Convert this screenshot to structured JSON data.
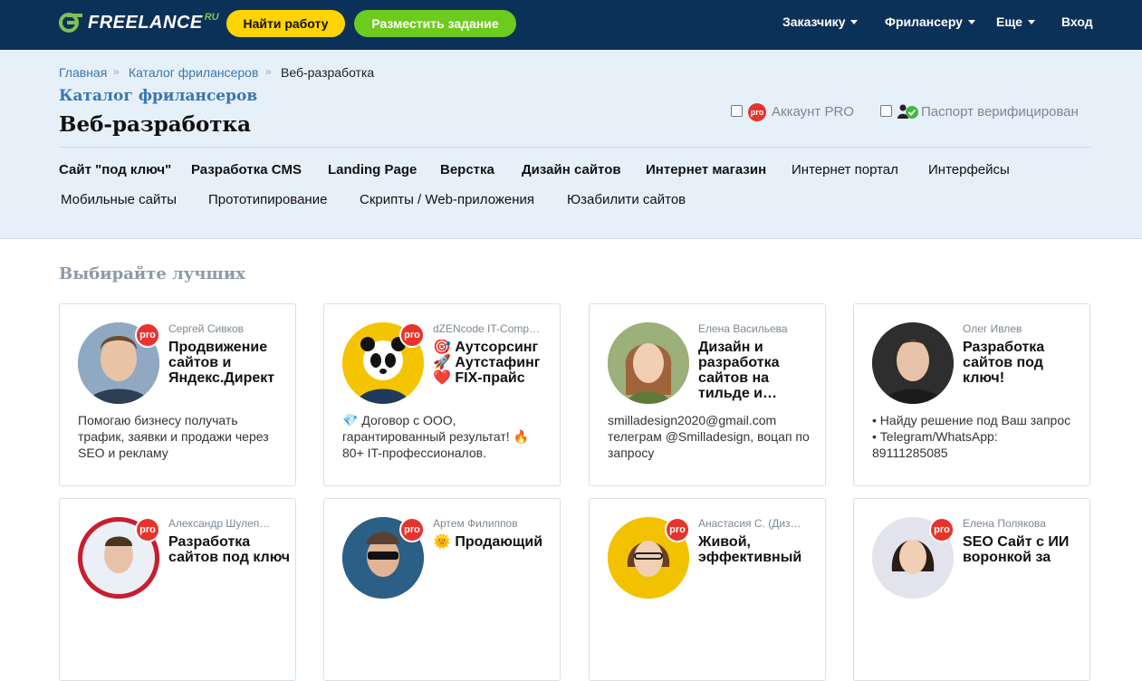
{
  "header": {
    "logo_text": "FREELANCE",
    "logo_ru": "RU",
    "find_work": "Найти работу",
    "post_task": "Разместить задание",
    "nav": [
      "Заказчику",
      "Фрилансеру",
      "Еще"
    ],
    "login": "Вход"
  },
  "breadcrumbs": [
    "Главная",
    "Каталог фрилансеров",
    "Веб-разработка"
  ],
  "breadcrumb_sep": "»",
  "catalog_link": "Каталог фрилансеров",
  "page_title": "Веб-разработка",
  "filters": {
    "pro_badge": "pro",
    "pro_label": "Аккаунт PRO",
    "passport_label": "Паспорт верифицирован"
  },
  "specs_row1": [
    "Сайт \"под ключ\"",
    "Разработка CMS",
    "Landing Page",
    "Верстка",
    "Дизайн сайтов",
    "Интернет магазин",
    "Интернет портал",
    "Интерфейсы"
  ],
  "specs_row2": [
    "Мобильные сайты",
    "Прототипирование",
    "Скрипты / Web-приложения",
    "Юзабилити сайтов"
  ],
  "section_title": "Выбирайте лучших",
  "cards": [
    {
      "name": "Сергей Сивков",
      "title": "Продвижение сайтов и Яндекс.Директ",
      "desc": "Помогаю бизнесу получать трафик, заявки и продажи через SEO и рекламу",
      "pro": "pro",
      "avatar_color": "#6b8fb3"
    },
    {
      "name": "dZENcode IT-Comp…",
      "title": "🎯 Аутсорсинг 🚀 Аутстафинг ❤️ FIX-прайс",
      "desc": "💎 Договор с ООО, гарантированный результат! 🔥 80+ IT-профессионалов.",
      "pro": "pro",
      "avatar_color": "#f2c200"
    },
    {
      "name": "Елена Васильева",
      "title": "Дизайн и разработка сайтов на тильде и…",
      "desc": "smilladesign2020@gmail.com телеграм @Smilladesign, воцап по запросу",
      "pro": "",
      "avatar_color": "#7f9a5a"
    },
    {
      "name": "Олег Ивлев",
      "title": "Разработка сайтов под ключ!",
      "desc": "• Найду решение под Ваш запрос • Telegram/WhatsApp: 89111285085",
      "pro": "",
      "avatar_color": "#3b3b3b"
    },
    {
      "name": "Александр Шулеп…",
      "title": "Разработка сайтов под ключ",
      "desc": "",
      "pro": "pro",
      "avatar_color": "#c81e2f"
    },
    {
      "name": "Артем Филиппов",
      "title": "🌞 Продающий",
      "desc": "",
      "pro": "pro",
      "avatar_color": "#2c5f86"
    },
    {
      "name": "Анастасия С. (Диз…",
      "title": "Живой, эффективный",
      "desc": "",
      "pro": "pro",
      "avatar_color": "#f2c200"
    },
    {
      "name": "Елена Полякова",
      "title": "SEO Сайт с ИИ воронкой за",
      "desc": "",
      "pro": "pro",
      "avatar_color": "#d9d9e8"
    }
  ]
}
